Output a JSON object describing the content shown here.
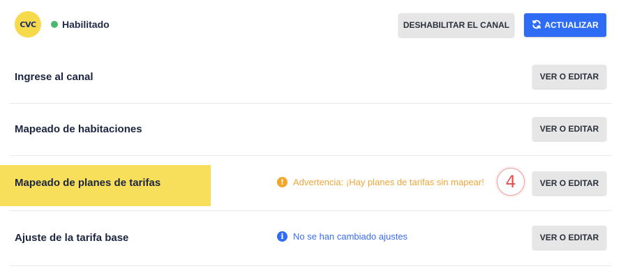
{
  "header": {
    "logo_text": "CVC",
    "status_label": "Habilitado",
    "status_color": "#48b86d",
    "disable_button_label": "DESHABILITAR EL CANAL",
    "update_button_label": "ACTUALIZAR",
    "update_icon": "refresh-icon"
  },
  "rows": [
    {
      "title": "Ingrese al canal",
      "button_label": "VER O EDITAR"
    },
    {
      "title": "Mapeado de habitaciones",
      "button_label": "VER O EDITAR"
    },
    {
      "title": "Mapeado de planes de tarifas",
      "button_label": "VER O EDITAR",
      "notice": {
        "type": "warning",
        "icon": "warning-icon",
        "text": "Advertencia: ¡Hay planes de tarifas sin mapear!"
      },
      "step_number": "4"
    },
    {
      "title": "Ajuste de la tarifa base",
      "button_label": "VER O EDITAR",
      "notice": {
        "type": "info",
        "icon": "info-icon",
        "text": "No se han cambiado ajustes"
      }
    }
  ],
  "colors": {
    "primary": "#2f6cf6",
    "warning": "#f0a63a",
    "highlight": "#f8df5b"
  }
}
